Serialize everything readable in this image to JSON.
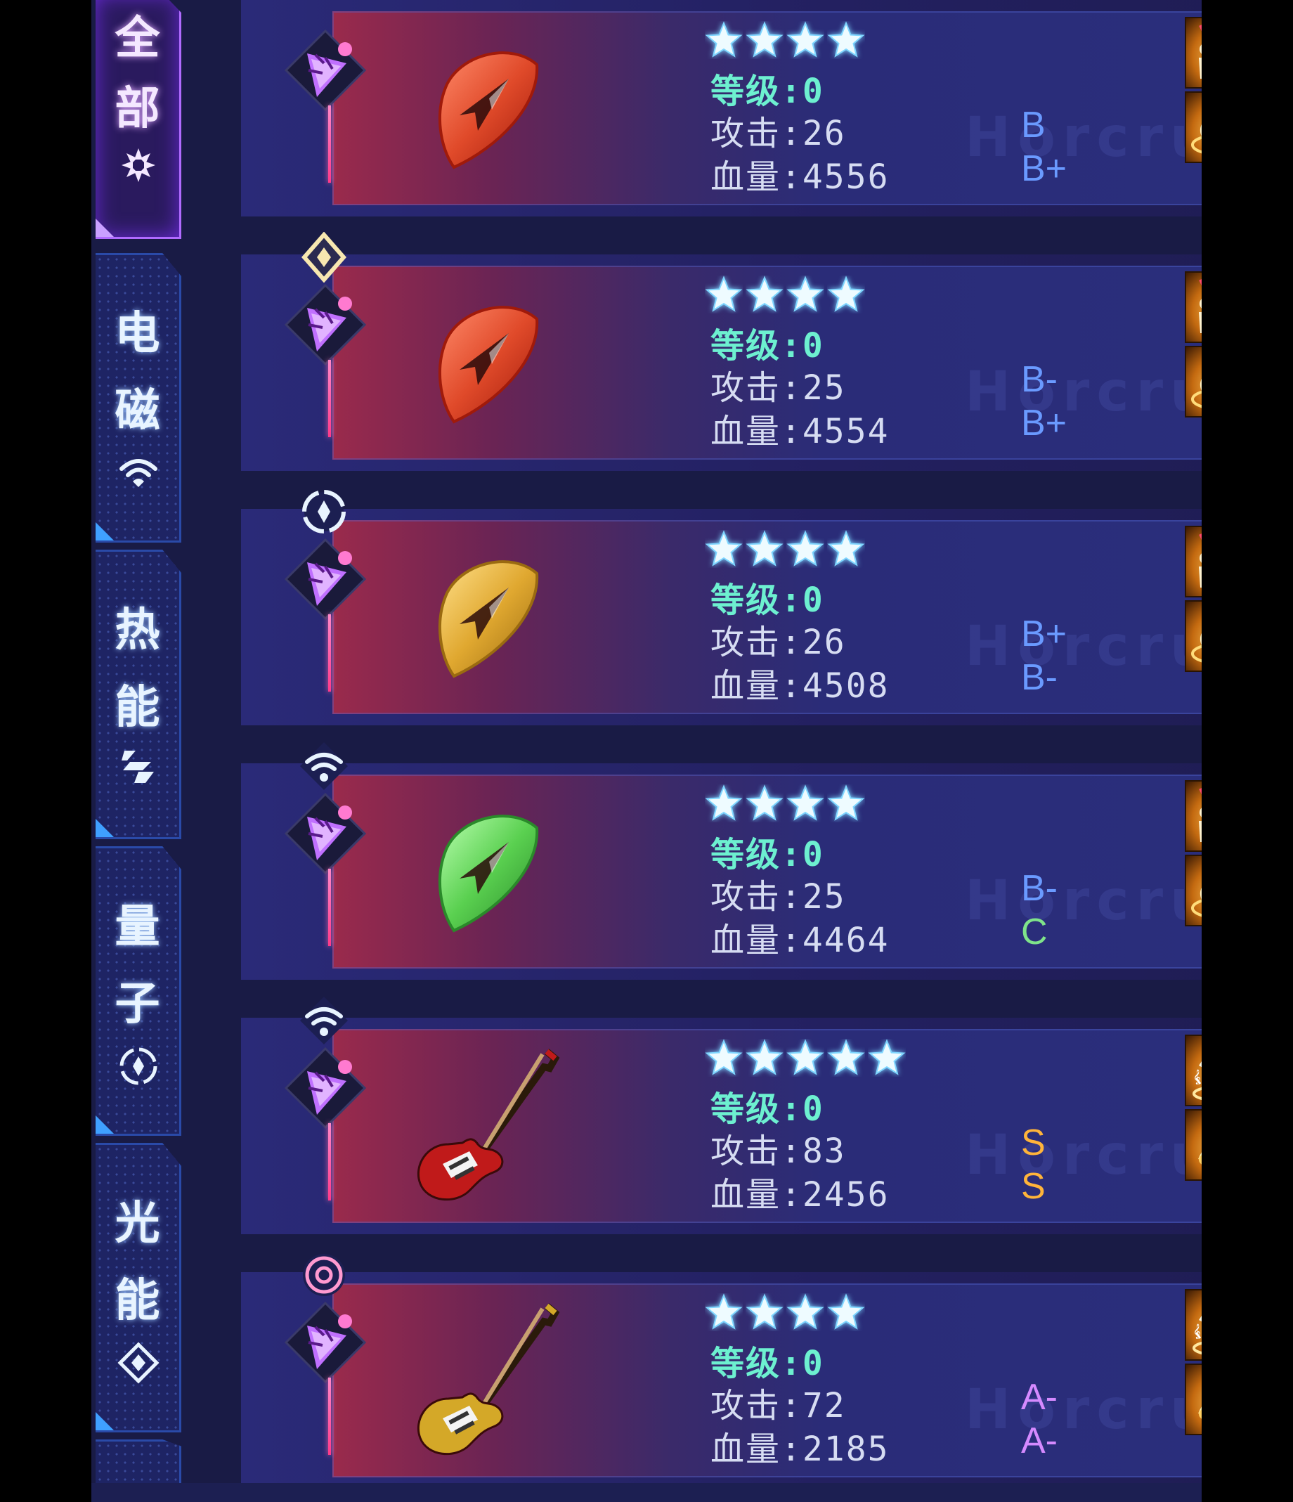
{
  "tabs": [
    {
      "label1": "全",
      "label2": "部",
      "icon": "all-icon",
      "active": true
    },
    {
      "label1": "电",
      "label2": "磁",
      "icon": "wifi-icon",
      "active": false
    },
    {
      "label1": "热",
      "label2": "能",
      "icon": "heat-icon",
      "active": false
    },
    {
      "label1": "量",
      "label2": "子",
      "icon": "quantum-icon",
      "active": false
    },
    {
      "label1": "光",
      "label2": "能",
      "icon": "light-icon",
      "active": false
    }
  ],
  "cards": [
    {
      "element": "diamond-icon",
      "item": "pick-red",
      "stars": 4,
      "level": "等级:0",
      "attack": "攻击:26",
      "hp": "血量:4556",
      "grade1": "B",
      "grade2": "B+",
      "grade1_color": "#6a9aff",
      "grade2_color": "#6a9aff",
      "skills": [
        "crowd-icon",
        "guitar-boost-icon"
      ]
    },
    {
      "element": "diamond-icon",
      "item": "pick-red",
      "stars": 4,
      "level": "等级:0",
      "attack": "攻击:25",
      "hp": "血量:4554",
      "grade1": "B-",
      "grade2": "B+",
      "grade1_color": "#6a9aff",
      "grade2_color": "#6a9aff",
      "skills": [
        "crowd-icon",
        "guitar-boost-icon"
      ]
    },
    {
      "element": "quantum-icon",
      "item": "pick-gold",
      "stars": 4,
      "level": "等级:0",
      "attack": "攻击:26",
      "hp": "血量:4508",
      "grade1": "B+",
      "grade2": "B-",
      "grade1_color": "#6a9aff",
      "grade2_color": "#6a9aff",
      "skills": [
        "crowd-icon",
        "guitar-boost-icon"
      ]
    },
    {
      "element": "wifi-icon",
      "item": "pick-green",
      "stars": 4,
      "level": "等级:0",
      "attack": "攻击:25",
      "hp": "血量:4464",
      "grade1": "B-",
      "grade2": "C",
      "grade1_color": "#6a9aff",
      "grade2_color": "#7fe38a",
      "skills": [
        "crowd-icon",
        "guitar-boost-icon"
      ]
    },
    {
      "element": "wifi-icon",
      "item": "guitar-red",
      "stars": 5,
      "level": "等级:0",
      "attack": "攻击:83",
      "hp": "血量:2456",
      "grade1": "S",
      "grade2": "S",
      "grade1_color": "#ffb43a",
      "grade2_color": "#ffb43a",
      "skills": [
        "dancer-icon",
        "music-note-icon"
      ]
    },
    {
      "element": "swirl-icon",
      "item": "guitar-gold",
      "stars": 4,
      "level": "等级:0",
      "attack": "攻击:72",
      "hp": "血量:2185",
      "grade1": "A-",
      "grade2": "A-",
      "grade1_color": "#d58aff",
      "grade2_color": "#d58aff",
      "skills": [
        "dancer-icon",
        "music-note-icon"
      ]
    }
  ],
  "watermark": "Horcrux",
  "colors": {
    "background": "#191b45",
    "level_text": "#6df0d0",
    "stat_text": "#d6dcf2",
    "pink_accent": "#ff5aa8"
  }
}
